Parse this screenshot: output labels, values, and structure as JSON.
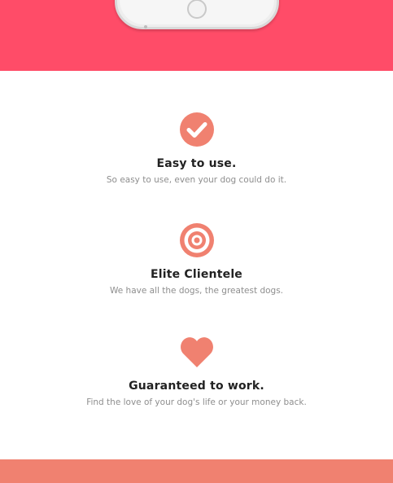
{
  "colors": {
    "hero_background": "#ff4c68",
    "accent": "#f08170",
    "heading": "#222222",
    "body_text": "#8e8e8e"
  },
  "features": [
    {
      "icon": "check-circle-icon",
      "title": "Easy to use.",
      "description": "So easy to use, even your dog could do it."
    },
    {
      "icon": "target-icon",
      "title": "Elite Clientele",
      "description": "We have all the dogs, the greatest dogs."
    },
    {
      "icon": "heart-icon",
      "title": "Guaranteed to work.",
      "description": "Find the love of your dog's life or your money back."
    }
  ]
}
